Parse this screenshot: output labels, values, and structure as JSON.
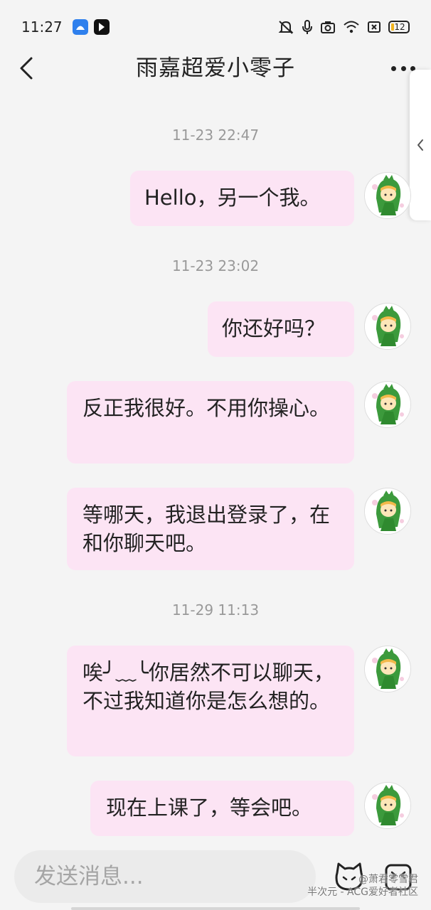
{
  "status_bar": {
    "time": "11:27",
    "battery": "12"
  },
  "header": {
    "title": "雨嘉超爱小零子"
  },
  "messages": [
    {
      "timestamp": "11-23 22:47",
      "text": "Hello，另一个我。"
    },
    {
      "timestamp": "11-23 23:02",
      "text": "你还好吗？"
    },
    {
      "text": "反正我很好。不用你操心。"
    },
    {
      "text": "等哪天，我退出登录了，在和你聊天吧。"
    },
    {
      "timestamp": "11-29 11:13",
      "text": "唉╯﹏╰你居然不可以聊天，不过我知道你是怎么想的。"
    },
    {
      "text": "现在上课了，等会吧。"
    }
  ],
  "input": {
    "placeholder": "发送消息..."
  },
  "watermark": {
    "line1": "@萧君零雪君",
    "line2": "半次元 - ACG爱好者社区"
  },
  "colors": {
    "bubble": "#fce4f4",
    "background": "#f4f4f4",
    "avatar_accent": "#3c9a3c"
  }
}
